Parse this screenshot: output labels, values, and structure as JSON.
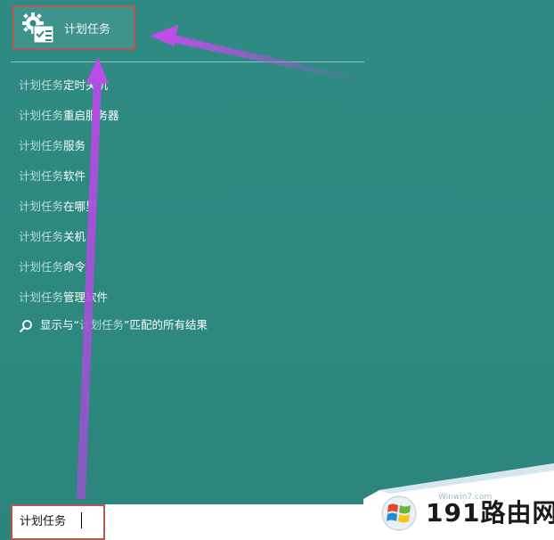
{
  "best_match": {
    "label": "计划任务",
    "icon": "task-scheduler-icon"
  },
  "results": [
    {
      "prefix": "计划任务",
      "suffix": "定时关机"
    },
    {
      "prefix": "计划任务",
      "suffix": "重启服务器"
    },
    {
      "prefix": "计划任务",
      "suffix": "服务"
    },
    {
      "prefix": "计划任务",
      "suffix": "软件"
    },
    {
      "prefix": "计划任务",
      "suffix": "在哪里"
    },
    {
      "prefix": "计划任务",
      "suffix": "关机"
    },
    {
      "prefix": "计划任务",
      "suffix": "命令"
    },
    {
      "prefix": "计划任务",
      "suffix": "管理软件"
    }
  ],
  "search_web": {
    "before": "显示与“",
    "term": "计划任务",
    "after": "”匹配的所有结果",
    "icon": "search-icon"
  },
  "search_bar": {
    "value": "计划任务"
  },
  "watermark": {
    "brand": "191路由网",
    "site": "Winwin7.com",
    "logo": "windows-logo-icon"
  },
  "colors": {
    "background": "#2f8b82",
    "highlight_box": "#b25a4e",
    "arrow": "#b14fe0"
  }
}
